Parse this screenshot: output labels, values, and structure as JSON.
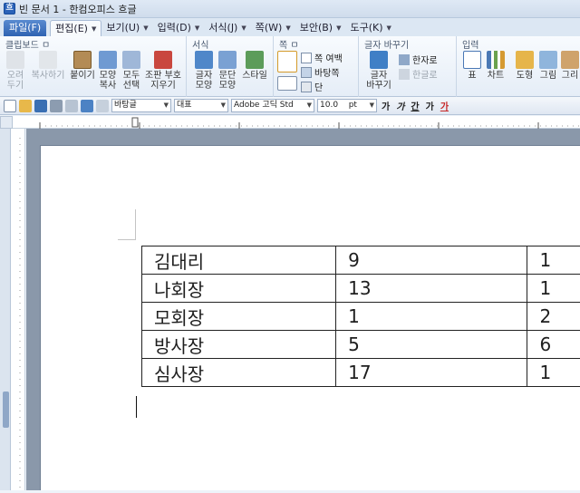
{
  "window": {
    "title": "빈 문서 1 - 한컴오피스 흐글"
  },
  "menu": {
    "file": "파일(F)",
    "tabs": [
      {
        "label": "편집(E)",
        "active": true
      },
      {
        "label": "보기(U)"
      },
      {
        "label": "입력(D)"
      },
      {
        "label": "서식(J)"
      },
      {
        "label": "쪽(W)"
      },
      {
        "label": "보안(B)"
      },
      {
        "label": "도구(K)"
      }
    ]
  },
  "ribbon": {
    "clipboard": {
      "title": "클립보드 ㅁ",
      "cut": "오려\n두기",
      "copy": "복사하기",
      "paste": "붙이기",
      "shape_copy": "모양\n복사",
      "select_all": "모두\n선택",
      "adjust": "조판 부호\n지우기"
    },
    "format": {
      "title": "서식",
      "char": "글자\n모양",
      "para": "문단\n모양",
      "style": "스타일"
    },
    "page": {
      "title": "쪽 ㅁ",
      "margin": "쪽 여백",
      "background": "바탕쪽",
      "columns": "단"
    },
    "convert": {
      "title": "글자 바꾸기",
      "hanja": "한자로",
      "hangul": "한글로",
      "change": "글자\n바꾸기"
    },
    "insert": {
      "title": "입력",
      "table": "표",
      "chart": "차트",
      "shape": "도형",
      "picture": "그림",
      "draw": "그리"
    }
  },
  "toolbar": {
    "style_combo": "바탕글",
    "lang_combo": "대표",
    "font_combo": "Adobe 고딕 Std",
    "size_combo": "10.0",
    "size_unit": "pt",
    "bold": "가",
    "italic": "가",
    "underline": "간",
    "strike": "가",
    "color": "가"
  },
  "table": {
    "rows": [
      [
        "김대리",
        "9",
        "1"
      ],
      [
        "나회장",
        "13",
        "1"
      ],
      [
        "모회장",
        "1",
        "2"
      ],
      [
        "방사장",
        "5",
        "6"
      ],
      [
        "심사장",
        "17",
        "1"
      ]
    ]
  },
  "colors": {
    "accent": "#2f63b2",
    "ribbon_bg": "#eef3f9",
    "workspace": "#8a98aa"
  }
}
